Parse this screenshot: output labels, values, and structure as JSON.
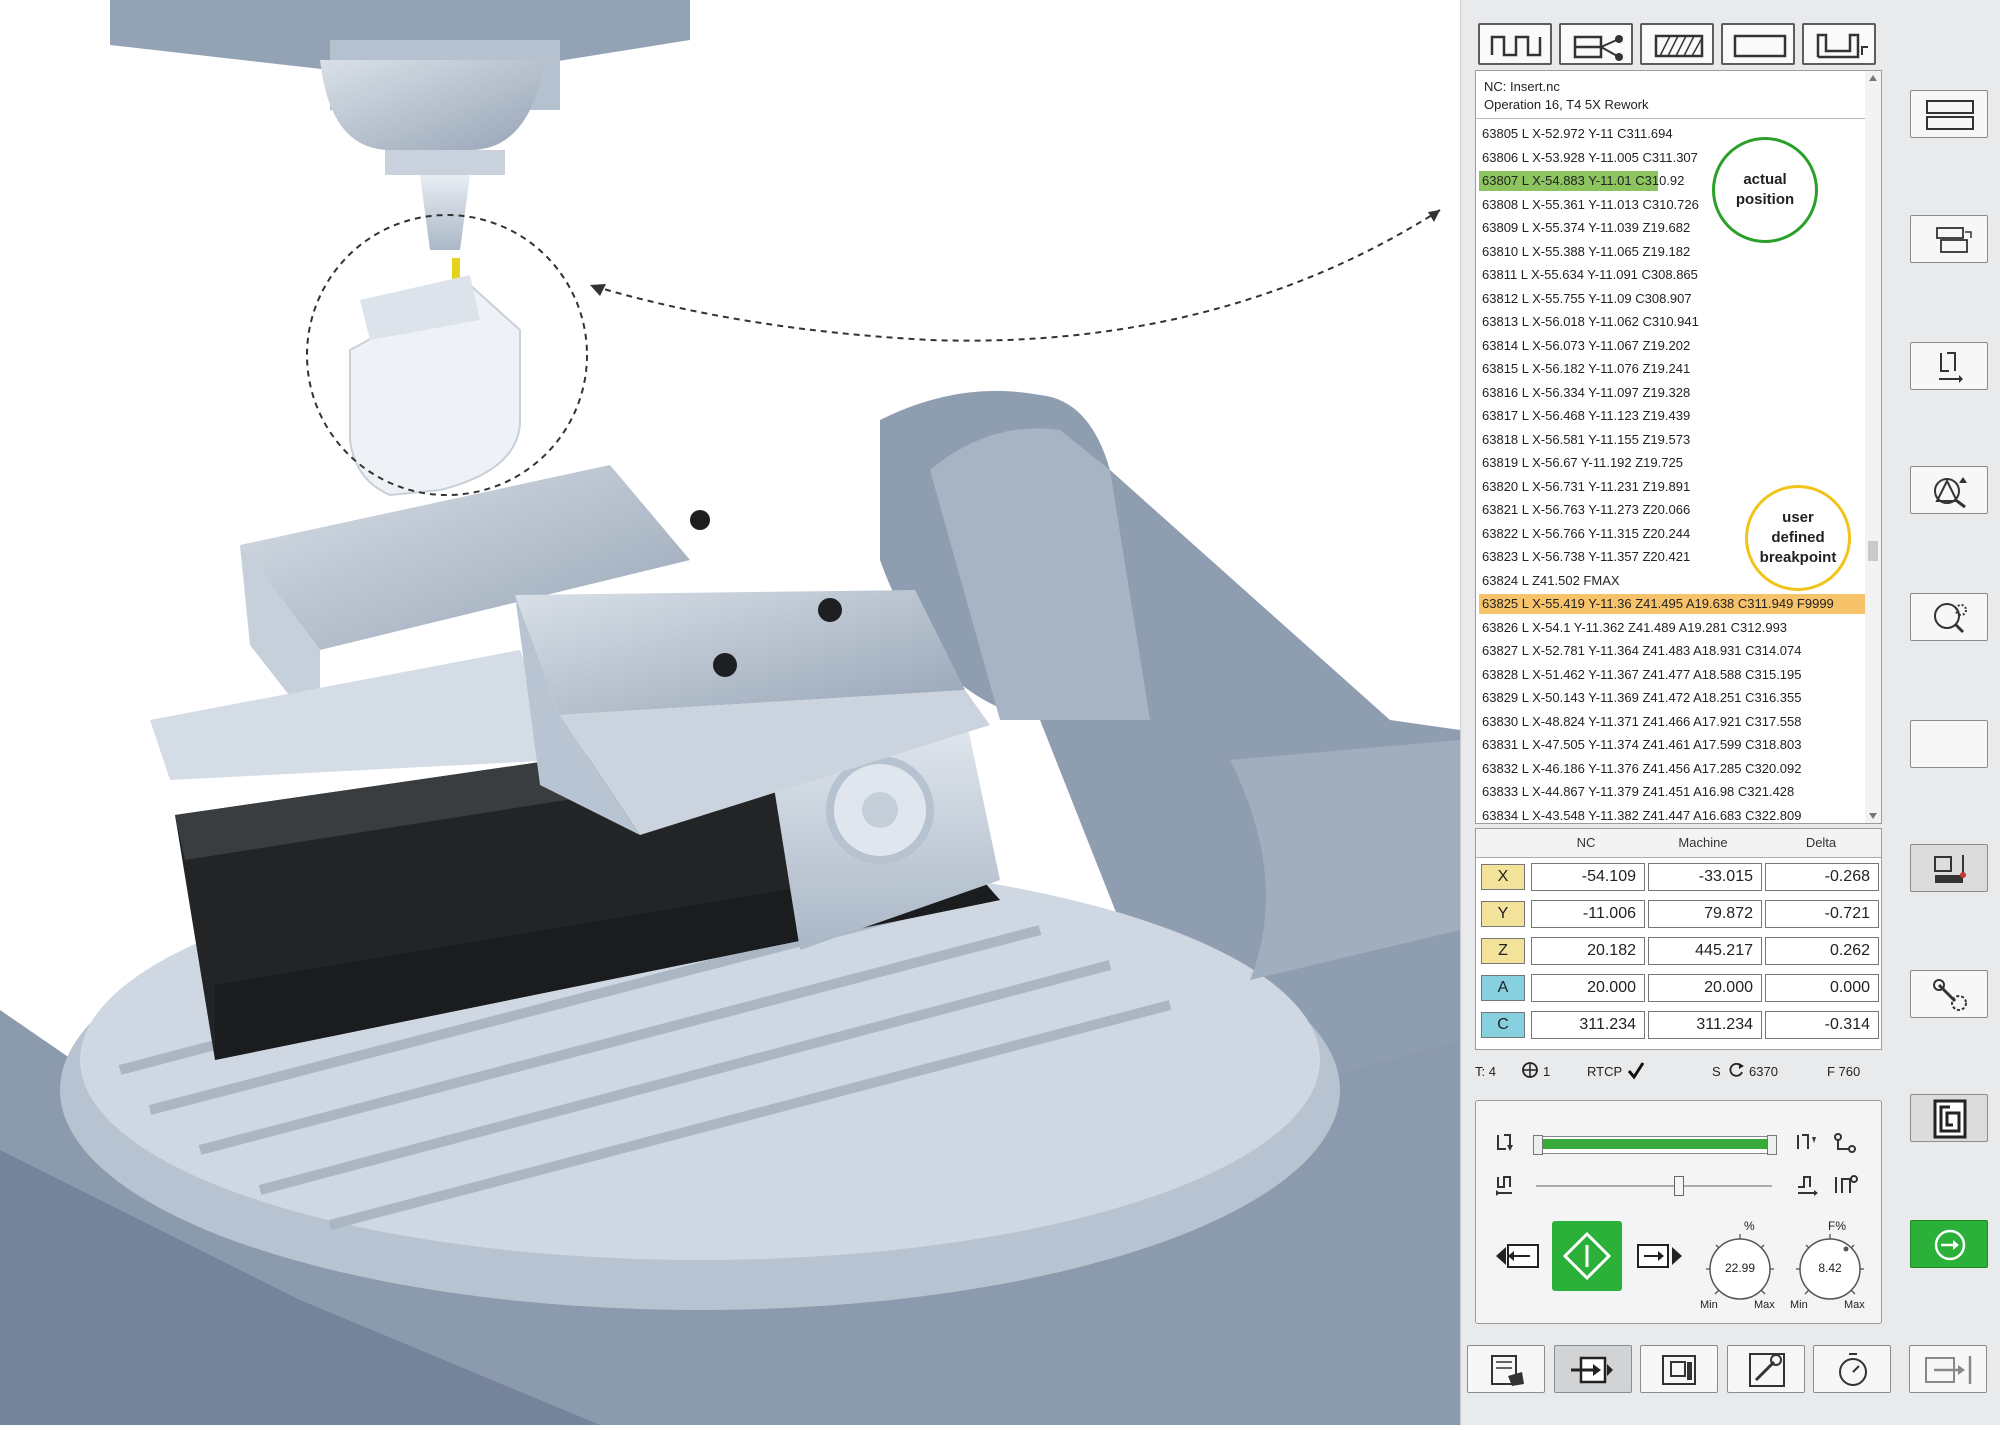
{
  "nc_program": {
    "file": "NC: Insert.nc",
    "operation": "Operation 16, T4 5X  Rework",
    "lines": [
      "63805 L X-52.972 Y-11 C311.694",
      "63806 L X-53.928 Y-11.005 C311.307",
      "63807 L X-54.883 Y-11.01 C310.92",
      "63808 L X-55.361 Y-11.013 C310.726",
      "63809 L X-55.374 Y-11.039 Z19.682",
      "63810 L X-55.388 Y-11.065 Z19.182",
      "63811 L X-55.634 Y-11.091 C308.865",
      "63812 L X-55.755 Y-11.09 C308.907",
      "63813 L X-56.018 Y-11.062 C310.941",
      "63814 L X-56.073 Y-11.067 Z19.202",
      "63815 L X-56.182 Y-11.076 Z19.241",
      "63816 L X-56.334 Y-11.097 Z19.328",
      "63817 L X-56.468 Y-11.123 Z19.439",
      "63818 L X-56.581 Y-11.155 Z19.573",
      "63819 L X-56.67 Y-11.192 Z19.725",
      "63820 L X-56.731 Y-11.231 Z19.891",
      "63821 L X-56.763 Y-11.273 Z20.066",
      "63822 L X-56.766 Y-11.315 Z20.244",
      "63823 L X-56.738 Y-11.357 Z20.421",
      "63824 L Z41.502 FMAX",
      "63825 L X-55.419 Y-11.36 Z41.495 A19.638 C311.949 F9999",
      "63826 L X-54.1 Y-11.362 Z41.489 A19.281 C312.993",
      "63827 L X-52.781 Y-11.364 Z41.483 A18.931 C314.074",
      "63828 L X-51.462 Y-11.367 Z41.477 A18.588 C315.195",
      "63829 L X-50.143 Y-11.369 Z41.472 A18.251 C316.355",
      "63830 L X-48.824 Y-11.371 Z41.466 A17.921 C317.558",
      "63831 L X-47.505 Y-11.374 Z41.461 A17.599 C318.803",
      "63832 L X-46.186 Y-11.376 Z41.456 A17.285 C320.092",
      "63833 L X-44.867 Y-11.379 Z41.451 A16.98 C321.428",
      "63834 L X-43.548 Y-11.382 Z41.447 A16.683 C322.809"
    ],
    "actual_line_index": 2,
    "breakpoint_line_index": 20
  },
  "callouts": {
    "actual_label": "actual position",
    "breakpoint_label": "user defined breakpoint",
    "actual_color": "#2aa02a",
    "breakpoint_color": "#f0c419"
  },
  "positions": {
    "headers": [
      "NC",
      "Machine",
      "Delta"
    ],
    "rows": [
      {
        "axis": "X",
        "nc": "-54.109",
        "machine": "-33.015",
        "delta": "-0.268",
        "color": "#f3e29a"
      },
      {
        "axis": "Y",
        "nc": "-11.006",
        "machine": "79.872",
        "delta": "-0.721",
        "color": "#f3e29a"
      },
      {
        "axis": "Z",
        "nc": "20.182",
        "machine": "445.217",
        "delta": "0.262",
        "color": "#f3e29a"
      },
      {
        "axis": "A",
        "nc": "20.000",
        "machine": "20.000",
        "delta": "0.000",
        "color": "#86d0e0"
      },
      {
        "axis": "C",
        "nc": "311.234",
        "machine": "311.234",
        "delta": "-0.314",
        "color": "#86d0e0"
      }
    ]
  },
  "status": {
    "tool": "T:  4",
    "origin": "1",
    "rtcp": "RTCP",
    "spindle_label": "S",
    "spindle": "6370",
    "feed": "F  760"
  },
  "controls": {
    "spindle_override": "22.99",
    "feed_override": "8.42",
    "spindle_dial_label": "%",
    "feed_dial_label": "F%",
    "dial_min": "Min",
    "dial_max": "Max",
    "progress_fraction": 1.0,
    "slider_fraction": 0.6,
    "start_button_color": "#2bb03a"
  }
}
